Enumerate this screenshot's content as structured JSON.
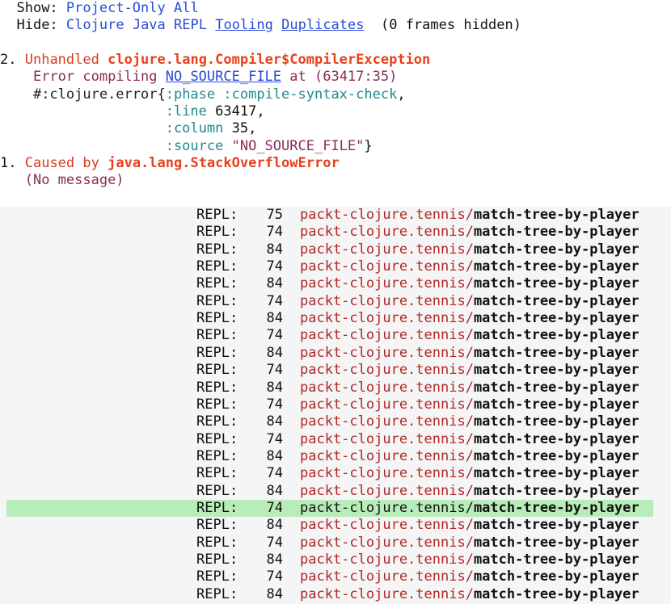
{
  "filters": {
    "show_label": "Show:",
    "show_options": [
      "Project-Only",
      "All"
    ],
    "hide_label": "Hide:",
    "hide_options": [
      "Clojure",
      "Java",
      "REPL",
      "Tooling",
      "Duplicates"
    ],
    "hidden_count": "(0 frames hidden)"
  },
  "exceptions": {
    "ex2": {
      "index": "2.",
      "prefix": "Unhandled",
      "class": "clojure.lang.Compiler$CompilerException",
      "msg_pre": "Error compiling",
      "msg_file": "NO_SOURCE_FILE",
      "msg_post": "at (63417:35)",
      "data_lines": [
        {
          "pre": "#:clojure.error{",
          "key": ":phase",
          "val": ":compile-syntax-check",
          "post": ","
        },
        {
          "pre": "",
          "key": ":line",
          "val": "63417",
          "post": ","
        },
        {
          "pre": "",
          "key": ":column",
          "val": "35",
          "post": ","
        },
        {
          "pre": "",
          "key": ":source",
          "val": "\"NO_SOURCE_FILE\"",
          "post": "}"
        }
      ]
    },
    "ex1": {
      "index": "1.",
      "prefix": "Caused by",
      "class": "java.lang.StackOverflowError",
      "msg": "(No message)"
    }
  },
  "frames": [
    {
      "src": "REPL:",
      "line": "75",
      "ns": "packt-clojure.tennis/",
      "fn": "match-tree-by-player"
    },
    {
      "src": "REPL:",
      "line": "74",
      "ns": "packt-clojure.tennis/",
      "fn": "match-tree-by-player"
    },
    {
      "src": "REPL:",
      "line": "84",
      "ns": "packt-clojure.tennis/",
      "fn": "match-tree-by-player"
    },
    {
      "src": "REPL:",
      "line": "74",
      "ns": "packt-clojure.tennis/",
      "fn": "match-tree-by-player"
    },
    {
      "src": "REPL:",
      "line": "84",
      "ns": "packt-clojure.tennis/",
      "fn": "match-tree-by-player"
    },
    {
      "src": "REPL:",
      "line": "74",
      "ns": "packt-clojure.tennis/",
      "fn": "match-tree-by-player"
    },
    {
      "src": "REPL:",
      "line": "84",
      "ns": "packt-clojure.tennis/",
      "fn": "match-tree-by-player"
    },
    {
      "src": "REPL:",
      "line": "74",
      "ns": "packt-clojure.tennis/",
      "fn": "match-tree-by-player"
    },
    {
      "src": "REPL:",
      "line": "84",
      "ns": "packt-clojure.tennis/",
      "fn": "match-tree-by-player"
    },
    {
      "src": "REPL:",
      "line": "74",
      "ns": "packt-clojure.tennis/",
      "fn": "match-tree-by-player"
    },
    {
      "src": "REPL:",
      "line": "84",
      "ns": "packt-clojure.tennis/",
      "fn": "match-tree-by-player"
    },
    {
      "src": "REPL:",
      "line": "74",
      "ns": "packt-clojure.tennis/",
      "fn": "match-tree-by-player"
    },
    {
      "src": "REPL:",
      "line": "84",
      "ns": "packt-clojure.tennis/",
      "fn": "match-tree-by-player"
    },
    {
      "src": "REPL:",
      "line": "74",
      "ns": "packt-clojure.tennis/",
      "fn": "match-tree-by-player"
    },
    {
      "src": "REPL:",
      "line": "84",
      "ns": "packt-clojure.tennis/",
      "fn": "match-tree-by-player"
    },
    {
      "src": "REPL:",
      "line": "74",
      "ns": "packt-clojure.tennis/",
      "fn": "match-tree-by-player"
    },
    {
      "src": "REPL:",
      "line": "84",
      "ns": "packt-clojure.tennis/",
      "fn": "match-tree-by-player"
    },
    {
      "src": "REPL:",
      "line": "74",
      "ns": "packt-clojure.tennis/",
      "fn": "match-tree-by-player",
      "selected": true
    },
    {
      "src": "REPL:",
      "line": "84",
      "ns": "packt-clojure.tennis/",
      "fn": "match-tree-by-player"
    },
    {
      "src": "REPL:",
      "line": "74",
      "ns": "packt-clojure.tennis/",
      "fn": "match-tree-by-player"
    },
    {
      "src": "REPL:",
      "line": "84",
      "ns": "packt-clojure.tennis/",
      "fn": "match-tree-by-player"
    },
    {
      "src": "REPL:",
      "line": "74",
      "ns": "packt-clojure.tennis/",
      "fn": "match-tree-by-player"
    },
    {
      "src": "REPL:",
      "line": "84",
      "ns": "packt-clojure.tennis/",
      "fn": "match-tree-by-player"
    }
  ],
  "colors": {
    "link": "#2a4bd7",
    "error_class": "#e8401c",
    "keyword": "#1f8a8a",
    "frame_ns": "#b0282a",
    "selected_row": "#b8ecb8",
    "frames_bg": "#f4f5f4"
  }
}
